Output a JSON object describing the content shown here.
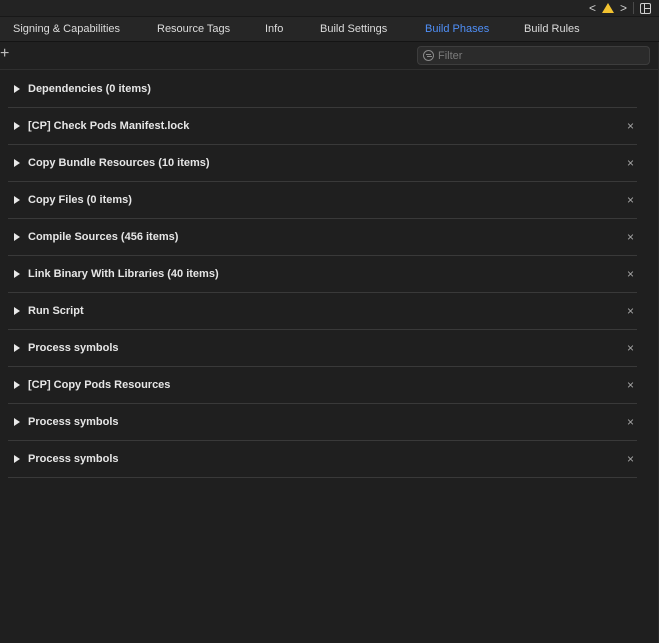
{
  "window": {
    "controls": {
      "back": "<",
      "forward": ">",
      "warning_icon": "warning-triangle-icon",
      "layout_icon": "editor-layout-icon"
    }
  },
  "tabs": [
    {
      "label": "Signing & Capabilities",
      "active": false
    },
    {
      "label": "Resource Tags",
      "active": false
    },
    {
      "label": "Info",
      "active": false
    },
    {
      "label": "Build Settings",
      "active": false
    },
    {
      "label": "Build Phases",
      "active": true
    },
    {
      "label": "Build Rules",
      "active": false
    }
  ],
  "toolbar": {
    "add_label": "+",
    "filter_placeholder": "Filter",
    "filter_value": ""
  },
  "phases": [
    {
      "label": "Dependencies (0 items)",
      "removable": false
    },
    {
      "label": "[CP] Check Pods Manifest.lock",
      "removable": true
    },
    {
      "label": "Copy Bundle Resources (10 items)",
      "removable": true
    },
    {
      "label": "Copy Files (0 items)",
      "removable": true
    },
    {
      "label": "Compile Sources (456 items)",
      "removable": true
    },
    {
      "label": "Link Binary With Libraries (40 items)",
      "removable": true
    },
    {
      "label": "Run Script",
      "removable": true
    },
    {
      "label": "Process symbols",
      "removable": true
    },
    {
      "label": "[CP] Copy Pods Resources",
      "removable": true
    },
    {
      "label": "Process symbols",
      "removable": true
    },
    {
      "label": "Process symbols",
      "removable": true
    }
  ],
  "close_glyph": "×",
  "colors": {
    "background": "#1f1f1f",
    "accent": "#4f8ff7",
    "warning": "#f2c230"
  }
}
